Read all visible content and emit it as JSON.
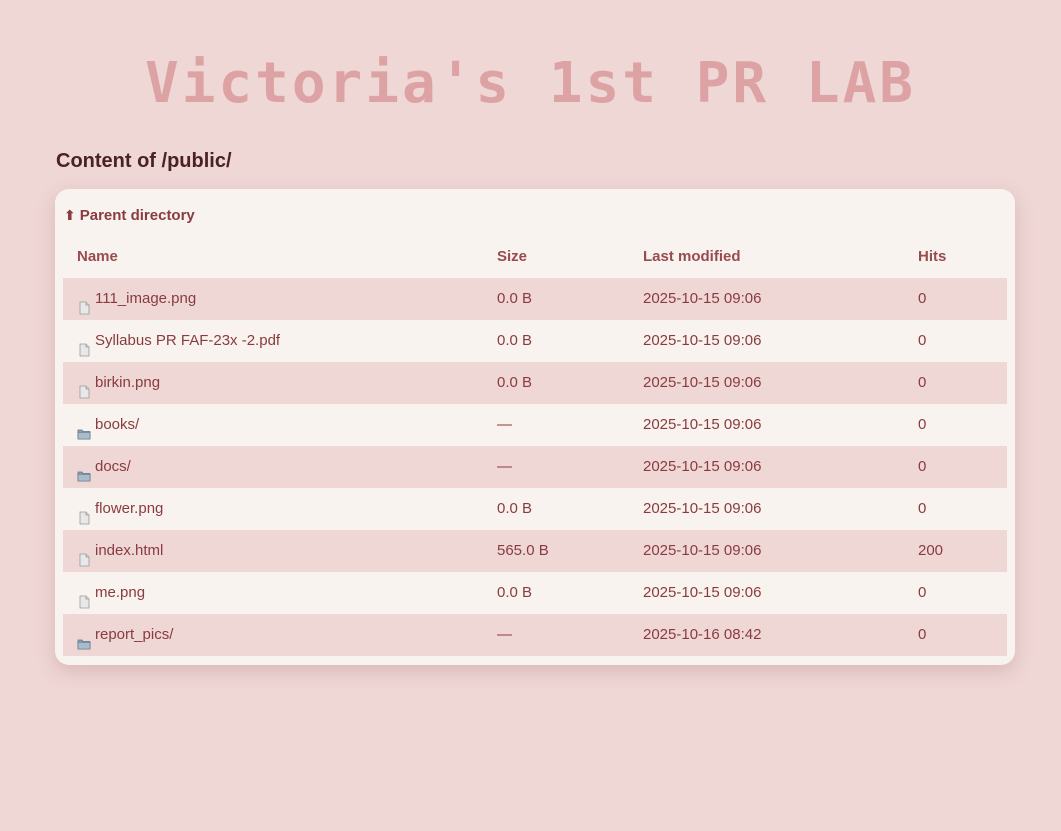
{
  "title": "Victoria's 1st PR LAB",
  "heading": "Content of /public/",
  "parent_link": {
    "label": "Parent directory",
    "icon": "up-arrow-icon"
  },
  "columns": {
    "name": "Name",
    "size": "Size",
    "modified": "Last modified",
    "hits": "Hits"
  },
  "rows": [
    {
      "icon": "file-icon",
      "name": "111_image.png",
      "size": "0.0 B",
      "modified": "2025-10-15 09:06",
      "hits": "0"
    },
    {
      "icon": "file-icon",
      "name": "Syllabus PR FAF-23x -2.pdf",
      "size": "0.0 B",
      "modified": "2025-10-15 09:06",
      "hits": "0"
    },
    {
      "icon": "file-icon",
      "name": "birkin.png",
      "size": "0.0 B",
      "modified": "2025-10-15 09:06",
      "hits": "0"
    },
    {
      "icon": "folder-icon",
      "name": "books/",
      "size": "—",
      "modified": "2025-10-15 09:06",
      "hits": "0"
    },
    {
      "icon": "folder-icon",
      "name": "docs/",
      "size": "—",
      "modified": "2025-10-15 09:06",
      "hits": "0"
    },
    {
      "icon": "file-icon",
      "name": "flower.png",
      "size": "0.0 B",
      "modified": "2025-10-15 09:06",
      "hits": "0"
    },
    {
      "icon": "file-icon",
      "name": "index.html",
      "size": "565.0 B",
      "modified": "2025-10-15 09:06",
      "hits": "200"
    },
    {
      "icon": "file-icon",
      "name": "me.png",
      "size": "0.0 B",
      "modified": "2025-10-15 09:06",
      "hits": "0"
    },
    {
      "icon": "folder-icon",
      "name": "report_pics/",
      "size": "—",
      "modified": "2025-10-16 08:42",
      "hits": "0"
    }
  ],
  "colors": {
    "background": "#efd7d6",
    "panel": "#f8f3ee",
    "title": "#dda3a4",
    "text": "#8a3b3f",
    "heading": "#4a2224"
  }
}
